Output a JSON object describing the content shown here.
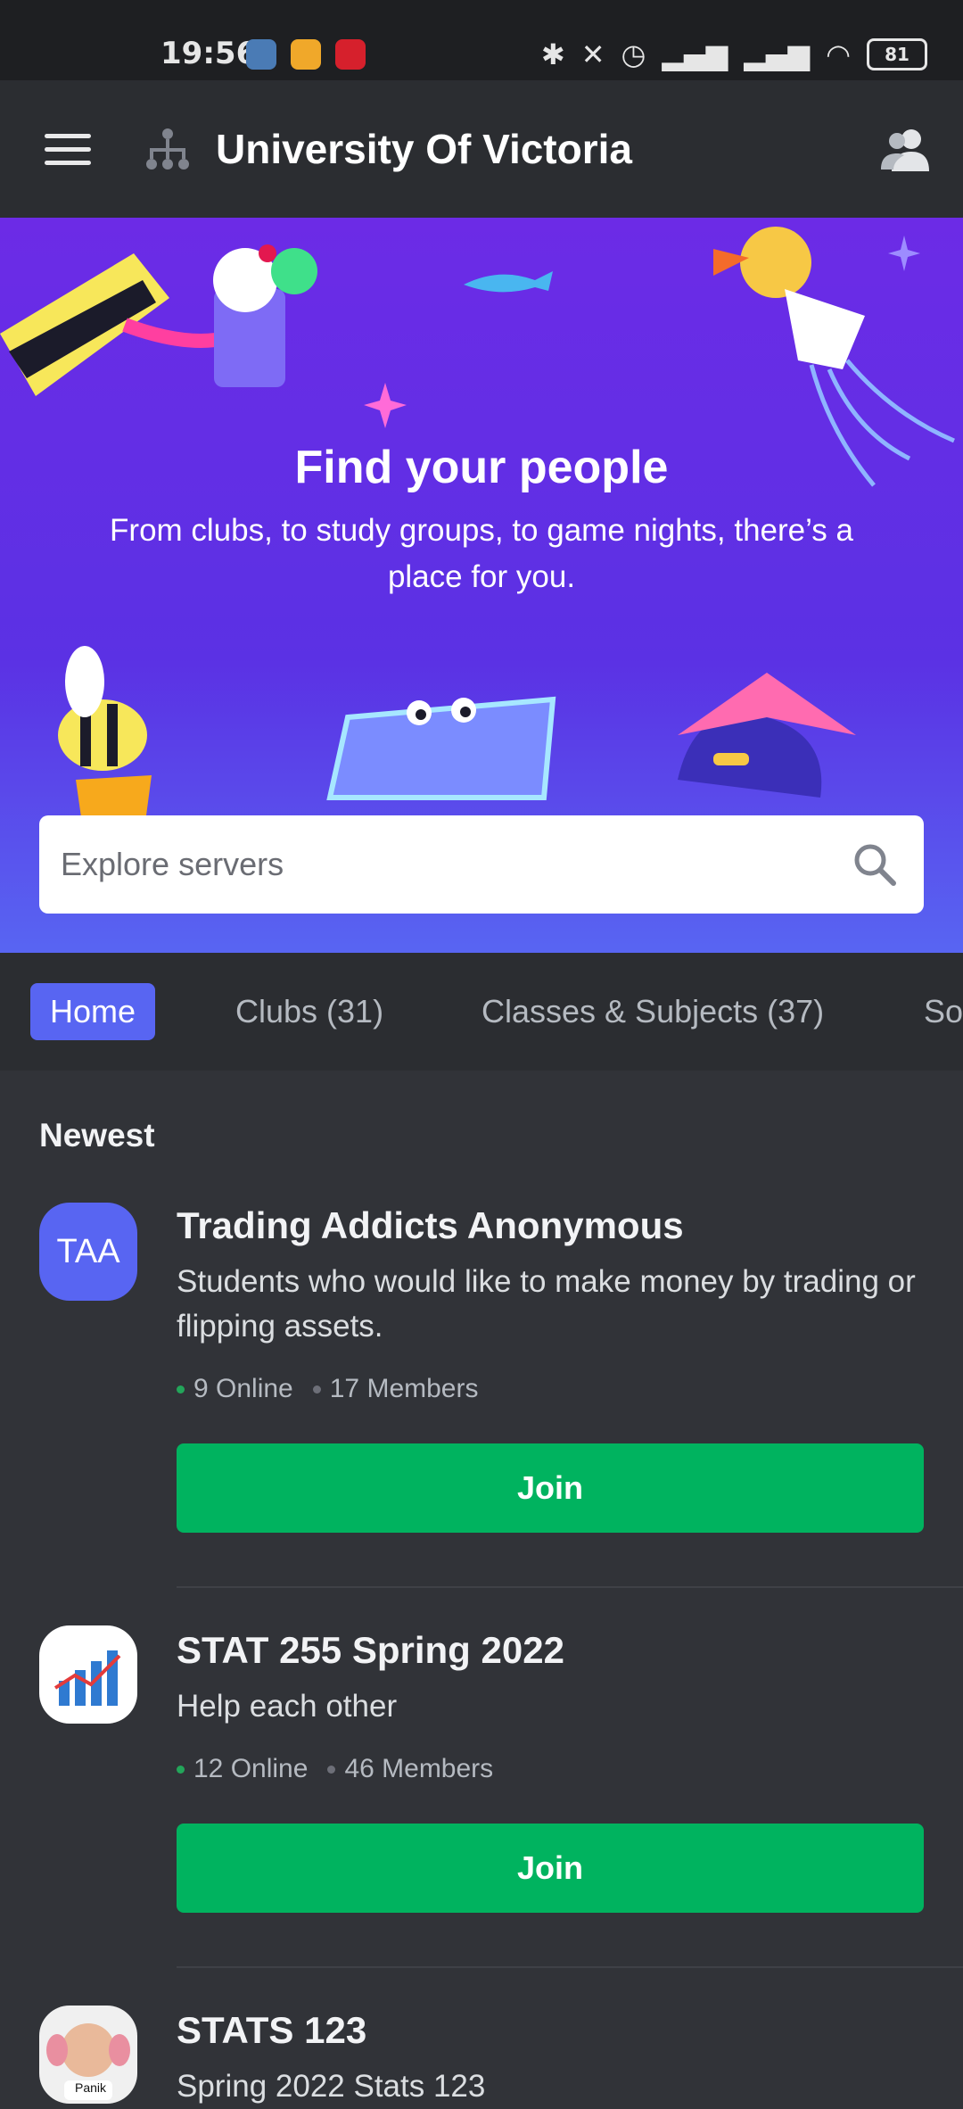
{
  "status_bar": {
    "time": "19:56",
    "battery": "81",
    "icons": [
      "settings-icon",
      "notes-icon",
      "target-icon",
      "bluetooth-icon",
      "mute-icon",
      "alarm-icon",
      "signal-icon",
      "signal-icon",
      "wifi-icon",
      "battery-icon"
    ]
  },
  "header": {
    "title": "University Of Victoria",
    "menu_icon": "hamburger-icon",
    "hub_icon": "hub-icon",
    "members_icon": "members-icon"
  },
  "hero": {
    "title": "Find your people",
    "subtitle": "From clubs, to study groups, to game nights, there’s a place for you.",
    "search_placeholder": "Explore servers",
    "colors": {
      "top": "#6c2be6",
      "bottom": "#5865f2"
    }
  },
  "tabs": [
    {
      "label": "Home",
      "active": true
    },
    {
      "label": "Clubs (31)",
      "active": false
    },
    {
      "label": "Classes & Subjects (37)",
      "active": false
    },
    {
      "label": "So",
      "active": false
    }
  ],
  "section": {
    "title": "Newest"
  },
  "servers": [
    {
      "icon_text": "TAA",
      "name": "Trading Addicts Anonymous",
      "description": "Students who would like to make money by trading or flipping assets.",
      "online": "9 Online",
      "members": "17 Members",
      "join_label": "Join"
    },
    {
      "icon_text": "",
      "name": "STAT 255 Spring 2022",
      "description": "Help each other",
      "online": "12 Online",
      "members": "46 Members",
      "join_label": "Join"
    },
    {
      "icon_text": "Panik",
      "name": "STATS 123",
      "description": "Spring 2022 Stats 123"
    }
  ],
  "colors": {
    "accent": "#5865f2",
    "join": "#00b35f",
    "online_dot": "#23a55a",
    "background": "#313338"
  }
}
